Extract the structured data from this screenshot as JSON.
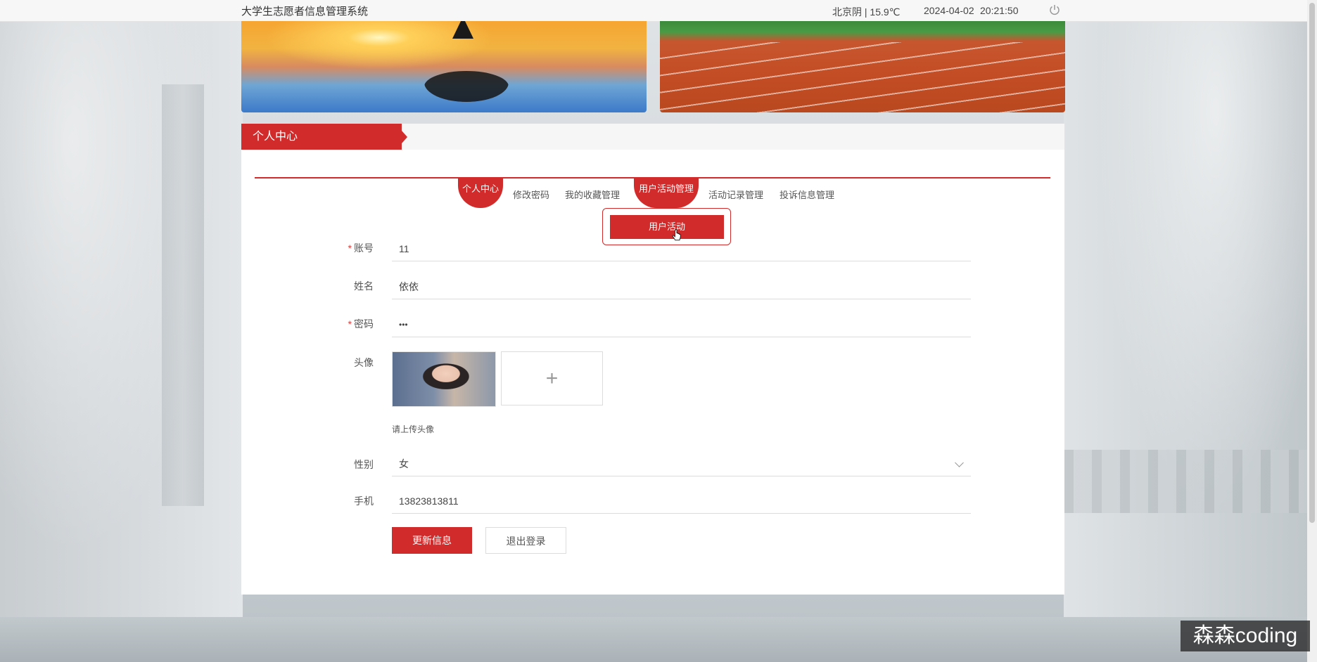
{
  "app": {
    "title": "大学生志愿者信息管理系统",
    "weather": "北京阴 | 15.9℃",
    "date": "2024-04-02",
    "time": "20:21:50"
  },
  "panel": {
    "title": "个人中心"
  },
  "tabs": [
    {
      "label": "个人中心",
      "active": true
    },
    {
      "label": "修改密码",
      "active": false
    },
    {
      "label": "我的收藏管理",
      "active": false
    },
    {
      "label": "用户活动管理",
      "active": true
    },
    {
      "label": "活动记录管理",
      "active": false
    },
    {
      "label": "投诉信息管理",
      "active": false
    }
  ],
  "dropdown": {
    "item": "用户活动"
  },
  "form": {
    "account": {
      "label": "账号",
      "required": "*",
      "value": "11"
    },
    "name": {
      "label": "姓名",
      "value": "依依"
    },
    "password": {
      "label": "密码",
      "required": "*",
      "value": "•••"
    },
    "avatar": {
      "label": "头像",
      "upload_icon": "+",
      "hint": "请上传头像"
    },
    "gender": {
      "label": "性别",
      "value": "女"
    },
    "phone": {
      "label": "手机",
      "value": "13823813811"
    }
  },
  "buttons": {
    "update": "更新信息",
    "logout": "退出登录"
  },
  "watermark": "森森coding",
  "colors": {
    "accent": "#d22b2b"
  }
}
